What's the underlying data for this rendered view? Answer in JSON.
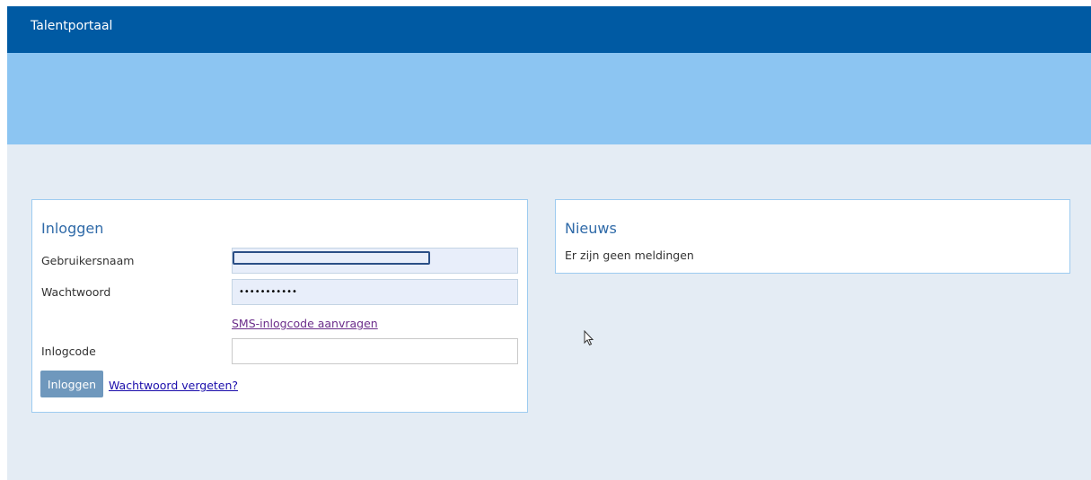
{
  "app": {
    "title": "Talentportaal"
  },
  "login": {
    "title": "Inloggen",
    "username_label": "Gebruikersnaam",
    "username_value": "",
    "password_label": "Wachtwoord",
    "password_value": "•••••••••••",
    "sms_link": "SMS-inlogcode aanvragen",
    "code_label": "Inlogcode",
    "code_value": "",
    "submit_label": "Inloggen",
    "forgot_link": "Wachtwoord vergeten?"
  },
  "news": {
    "title": "Nieuws",
    "message": "Er zijn geen meldingen"
  },
  "colors": {
    "topbar": "#005aa3",
    "banner": "#8cc5f2",
    "background": "#e4ecf4",
    "panel_title": "#2f6aa8",
    "button": "#6f98bd",
    "visited_link": "#6b2d8a",
    "link": "#1a0dab"
  }
}
